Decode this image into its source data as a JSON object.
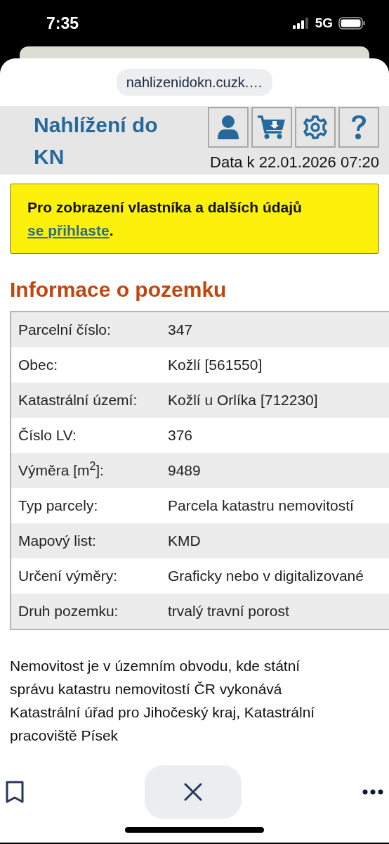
{
  "status_bar": {
    "time": "7:35",
    "network": "5G"
  },
  "browser": {
    "url": "nahlizenidokn.cuzk.…"
  },
  "header": {
    "title": "Nahlížení do KN",
    "data_date": "Data k 22.01.2026 07:20"
  },
  "notice": {
    "text": "Pro zobrazení vlastníka a dalších údajů",
    "link": "se přihlaste",
    "suffix": "."
  },
  "section_title": "Informace o pozemku",
  "table": {
    "rows": [
      {
        "label": "Parcelní číslo:",
        "value": "347"
      },
      {
        "label": "Obec:",
        "value": "Kožlí [561550]"
      },
      {
        "label": "Katastrální území:",
        "value": "Kožlí u Orlíka [712230]"
      },
      {
        "label": "Číslo LV:",
        "value": "376"
      },
      {
        "label": "Výměra [m$^{2}$]:",
        "value": "9489"
      },
      {
        "label": "Typ parcely:",
        "value": "Parcela katastru nemovitostí"
      },
      {
        "label": "Mapový list:",
        "value": "KMD"
      },
      {
        "label": "Určení výměry:",
        "value": "Graficky nebo v digitalizované"
      },
      {
        "label": "Druh pozemku:",
        "value": "trvalý travní porost"
      }
    ]
  },
  "paragraph": "Nemovitost je v územním obvodu, kde státní správu katastru nemovitostí ČR vykonává Katastrální úřad pro Jihočeský kraj, Katastrální pracoviště Písek"
}
